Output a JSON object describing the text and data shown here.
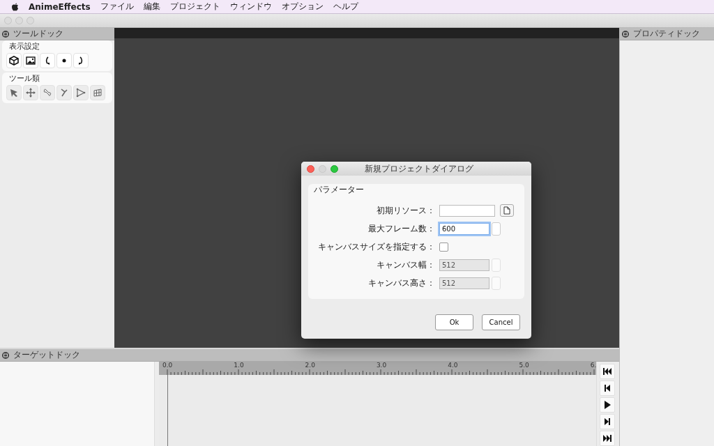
{
  "menubar": {
    "app": "AnimeEffects",
    "items": [
      "ファイル",
      "編集",
      "プロジェクト",
      "ウィンドウ",
      "オプション",
      "ヘルプ"
    ]
  },
  "tool_dock": {
    "title": "ツールドック",
    "sections": [
      {
        "title": "表示設定",
        "disabled": false
      },
      {
        "title": "ツール類",
        "disabled": true
      }
    ]
  },
  "property_dock": {
    "title": "プロパティドック"
  },
  "dialog": {
    "title": "新規プロジェクトダイアログ",
    "group": "パラメーター",
    "fields": [
      {
        "kind": "file",
        "label": "初期リソース："
      },
      {
        "kind": "spin",
        "label": "最大フレーム数：",
        "value": "600",
        "disabled": false,
        "focused": true
      },
      {
        "kind": "check",
        "label": "キャンバスサイズを指定する：",
        "checked": false
      },
      {
        "kind": "spin",
        "label": "キャンバス幅：",
        "value": "512",
        "disabled": true,
        "focused": false
      },
      {
        "kind": "spin",
        "label": "キャンバス高さ：",
        "value": "512",
        "disabled": true,
        "focused": false
      }
    ],
    "buttons": [
      "Ok",
      "Cancel"
    ]
  },
  "target_dock": {
    "title": "ターゲットドック"
  },
  "timeline": {
    "ruler_labels": [
      "0.0",
      "1.0",
      "2.0",
      "3.0",
      "4.0",
      "5.0",
      "6."
    ]
  }
}
